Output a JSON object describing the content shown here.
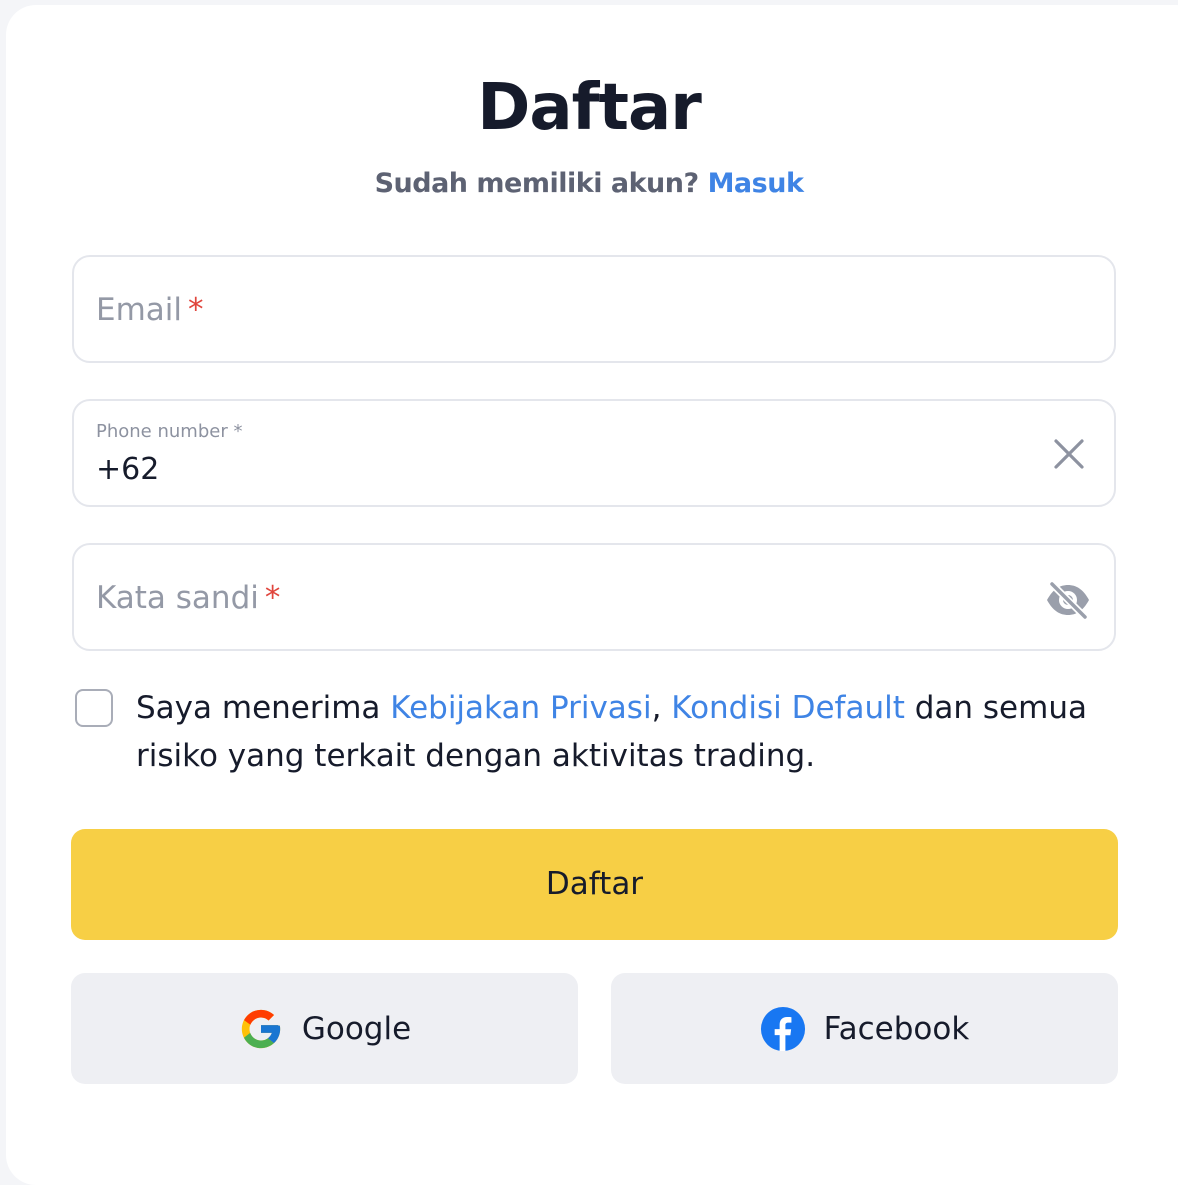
{
  "header": {
    "title": "Daftar",
    "subtitle_text": "Sudah memiliki akun?",
    "login_link": "Masuk"
  },
  "form": {
    "email": {
      "placeholder": "Email",
      "required_mark": "*"
    },
    "phone": {
      "label": "Phone number *",
      "value": "+62"
    },
    "password": {
      "placeholder": "Kata sandi",
      "required_mark": "*"
    },
    "consent": {
      "checked": false,
      "text_before": "Saya menerima",
      "privacy_link": "Kebijakan Privasi",
      "separator": ",",
      "default_link": "Kondisi Default",
      "text_after": "dan semua risiko yang terkait dengan aktivitas trading."
    },
    "submit_label": "Daftar"
  },
  "social": {
    "google_label": "Google",
    "facebook_label": "Facebook"
  },
  "colors": {
    "accent_link": "#3f84e5",
    "submit_bg": "#f7cf45",
    "required": "#e0463d",
    "social_bg": "#eeeff3",
    "facebook_blue": "#1877f2"
  },
  "icons": {
    "clear": "close-icon",
    "password_toggle": "eye-off-icon",
    "google": "google-icon",
    "facebook": "facebook-icon"
  }
}
